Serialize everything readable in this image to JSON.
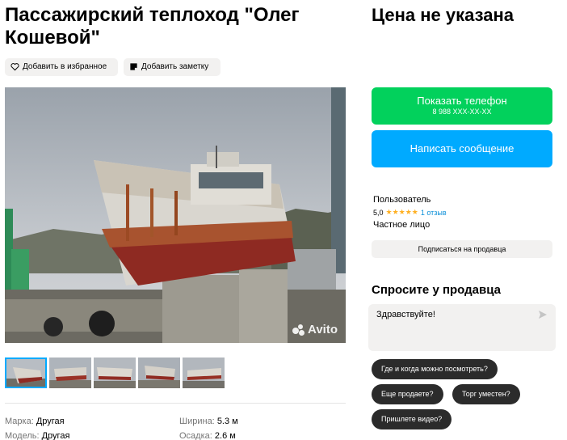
{
  "listing": {
    "title": "Пассажирский теплоход \"Олег Кошевой\"",
    "price": "Цена не указана"
  },
  "actions": {
    "favorite": "Добавить в избранное",
    "note": "Добавить заметку"
  },
  "gallery": {
    "watermark": "Avito",
    "thumbnail_count": 5
  },
  "params": [
    {
      "key": "Марка:",
      "value": "Другая"
    },
    {
      "key": "Модель:",
      "value": "Другая"
    },
    {
      "key": "Ширина:",
      "value": "5.3 м"
    },
    {
      "key": "Осадка:",
      "value": "2.6 м"
    }
  ],
  "contact": {
    "call_label": "Показать телефон",
    "phone_masked": "8 988 XXX-XX-XX",
    "message_label": "Написать сообщение"
  },
  "seller": {
    "name": "Пользователь",
    "rating": "5,0",
    "stars": "★★★★★",
    "reviews": "1 отзыв",
    "type": "Частное лицо",
    "subscribe_label": "Подписаться на продавца"
  },
  "ask": {
    "title": "Спросите у продавца",
    "message": "Здравствуйте!",
    "quick_questions": [
      "Где и когда можно посмотреть?",
      "Еще продаете?",
      "Торг уместен?",
      "Пришлете видео?"
    ]
  },
  "colors": {
    "call_green": "#02d15c",
    "message_blue": "#00aaff",
    "chip_dark": "#2b2b2b",
    "star_yellow": "#ffb021"
  }
}
